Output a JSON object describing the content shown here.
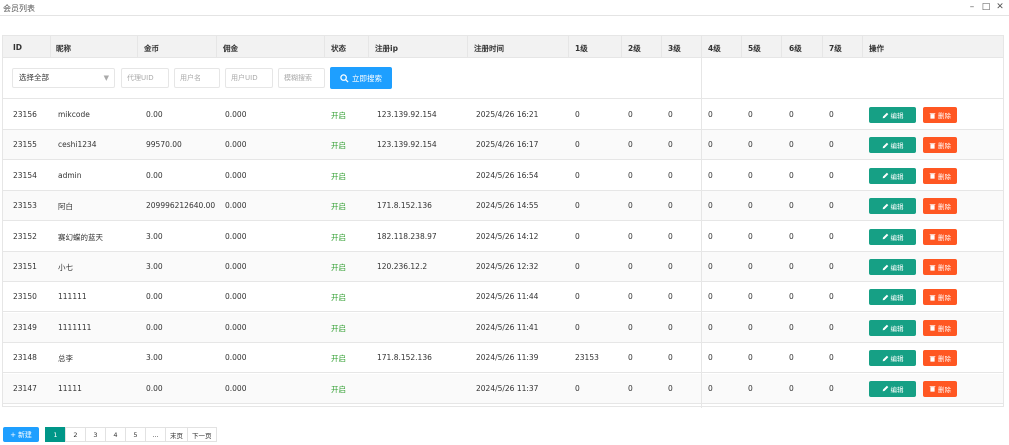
{
  "window": {
    "title": "会员列表",
    "minimize": "–",
    "maximize": "□",
    "close": "✕"
  },
  "columns": [
    "ID",
    "昵称",
    "金币",
    "佣金",
    "状态",
    "注册ip",
    "注册时间",
    "1级",
    "2级",
    "3级",
    "4级",
    "5级",
    "6级",
    "7级",
    "操作"
  ],
  "filters": {
    "select_value": "选择全部",
    "agent_uid_placeholder": "代理UID",
    "username_placeholder": "用户名",
    "user_uid_placeholder": "用户UID",
    "fuzzy_placeholder": "模糊搜索",
    "search_label": "立即搜索"
  },
  "actions": {
    "edit_label": "编辑",
    "delete_label": "删除"
  },
  "rows": [
    {
      "id": "23156",
      "nick": "mikcode",
      "gold": "0.00",
      "commission": "0.000",
      "status": "开启",
      "ip": "123.139.92.154",
      "time": "2025/4/26 16:21",
      "l1": "0",
      "l2": "0",
      "l3": "0",
      "l4": "0",
      "l5": "0",
      "l6": "0",
      "l7": "0"
    },
    {
      "id": "23155",
      "nick": "ceshi1234",
      "gold": "99570.00",
      "commission": "0.000",
      "status": "开启",
      "ip": "123.139.92.154",
      "time": "2025/4/26 16:17",
      "l1": "0",
      "l2": "0",
      "l3": "0",
      "l4": "0",
      "l5": "0",
      "l6": "0",
      "l7": "0"
    },
    {
      "id": "23154",
      "nick": "admin",
      "gold": "0.00",
      "commission": "0.000",
      "status": "开启",
      "ip": "",
      "time": "2024/5/26 16:54",
      "l1": "0",
      "l2": "0",
      "l3": "0",
      "l4": "0",
      "l5": "0",
      "l6": "0",
      "l7": "0"
    },
    {
      "id": "23153",
      "nick": "阿白",
      "gold": "209996212640.00",
      "commission": "0.000",
      "status": "开启",
      "ip": "171.8.152.136",
      "time": "2024/5/26 14:55",
      "l1": "0",
      "l2": "0",
      "l3": "0",
      "l4": "0",
      "l5": "0",
      "l6": "0",
      "l7": "0"
    },
    {
      "id": "23152",
      "nick": "赛幻蝶的蓝天",
      "gold": "3.00",
      "commission": "0.000",
      "status": "开启",
      "ip": "182.118.238.97",
      "time": "2024/5/26 14:12",
      "l1": "0",
      "l2": "0",
      "l3": "0",
      "l4": "0",
      "l5": "0",
      "l6": "0",
      "l7": "0"
    },
    {
      "id": "23151",
      "nick": "小七",
      "gold": "3.00",
      "commission": "0.000",
      "status": "开启",
      "ip": "120.236.12.2",
      "time": "2024/5/26 12:32",
      "l1": "0",
      "l2": "0",
      "l3": "0",
      "l4": "0",
      "l5": "0",
      "l6": "0",
      "l7": "0"
    },
    {
      "id": "23150",
      "nick": "111111",
      "gold": "0.00",
      "commission": "0.000",
      "status": "开启",
      "ip": "",
      "time": "2024/5/26 11:44",
      "l1": "0",
      "l2": "0",
      "l3": "0",
      "l4": "0",
      "l5": "0",
      "l6": "0",
      "l7": "0"
    },
    {
      "id": "23149",
      "nick": "1111111",
      "gold": "0.00",
      "commission": "0.000",
      "status": "开启",
      "ip": "",
      "time": "2024/5/26 11:41",
      "l1": "0",
      "l2": "0",
      "l3": "0",
      "l4": "0",
      "l5": "0",
      "l6": "0",
      "l7": "0"
    },
    {
      "id": "23148",
      "nick": "总李",
      "gold": "3.00",
      "commission": "0.000",
      "status": "开启",
      "ip": "171.8.152.136",
      "time": "2024/5/26 11:39",
      "l1": "23153",
      "l2": "0",
      "l3": "0",
      "l4": "0",
      "l5": "0",
      "l6": "0",
      "l7": "0"
    },
    {
      "id": "23147",
      "nick": "11111",
      "gold": "0.00",
      "commission": "0.000",
      "status": "开启",
      "ip": "",
      "time": "2024/5/26 11:37",
      "l1": "0",
      "l2": "0",
      "l3": "0",
      "l4": "0",
      "l5": "0",
      "l6": "0",
      "l7": "0"
    }
  ],
  "footer": {
    "add_label": "新建",
    "pages": [
      "1",
      "2",
      "3",
      "4",
      "5",
      "...",
      "末页",
      "下一页"
    ],
    "current_page": "1"
  },
  "colors": {
    "search_blue": "#1e9fff",
    "edit_teal": "#16a085",
    "delete_orange": "#ff5722",
    "status_green": "#2e9e2e",
    "page_active": "#009688"
  }
}
